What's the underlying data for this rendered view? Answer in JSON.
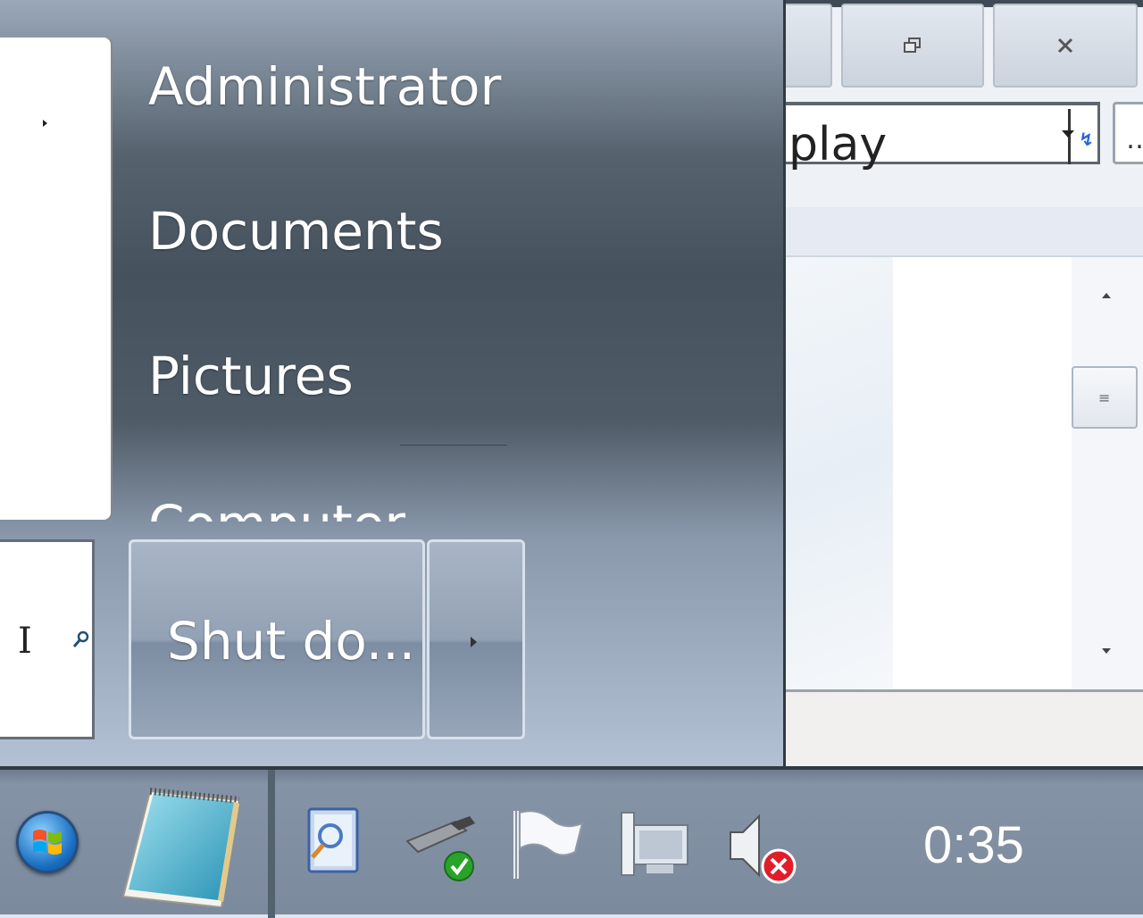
{
  "background_window": {
    "address_text": "play",
    "more_label": "…"
  },
  "start_menu": {
    "places": [
      {
        "label": "Administrator"
      },
      {
        "label": "Documents"
      },
      {
        "label": "Pictures"
      },
      {
        "label": "Computer"
      }
    ],
    "shutdown_label": "Shut do...",
    "search_cursor": "I"
  },
  "taskbar": {
    "clock": "0:35",
    "pinned": [
      "notepad-icon"
    ],
    "tray_icons": [
      "explorer-search-icon",
      "usb-safely-remove-icon",
      "action-center-flag-icon",
      "network-icon",
      "volume-muted-icon"
    ]
  }
}
